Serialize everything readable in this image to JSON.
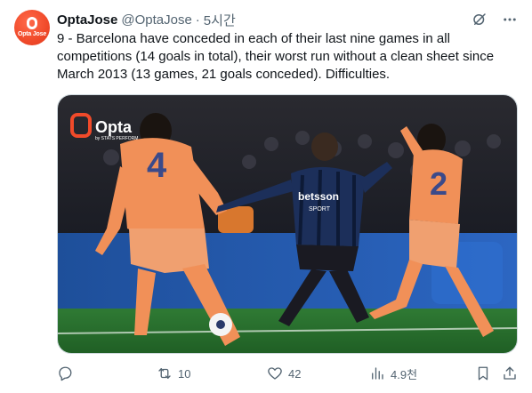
{
  "author": {
    "display_name": "OptaJose",
    "handle": "@OptaJose",
    "separator": "·",
    "time": "5시간",
    "avatar_text": "Opta Jose"
  },
  "tweet": {
    "text": "9 - Barcelona have conceded in each of their last nine games in all competitions (14 goals in total), their worst run without a clean sheet since March 2013 (13 games, 21 goals conceded). Difficulties."
  },
  "media": {
    "logo_text": "Opta",
    "logo_subtext": "by STATS PERFORM",
    "sponsor_text": "betsson",
    "sponsor_subtext": "SPORT",
    "player_left_number": "4",
    "player_right_number": "2"
  },
  "actions": {
    "reply_count": "",
    "retweet_count": "10",
    "like_count": "42",
    "views_count": "4.9천"
  },
  "icons": {
    "reply": "reply-icon",
    "retweet": "retweet-icon",
    "like": "heart-icon",
    "views": "views-icon",
    "bookmark": "bookmark-icon",
    "share": "share-icon",
    "grok": "grok-icon",
    "more": "more-icon"
  },
  "colors": {
    "text_primary": "#0f1419",
    "text_secondary": "#536471",
    "brand": "#f04a2a"
  }
}
